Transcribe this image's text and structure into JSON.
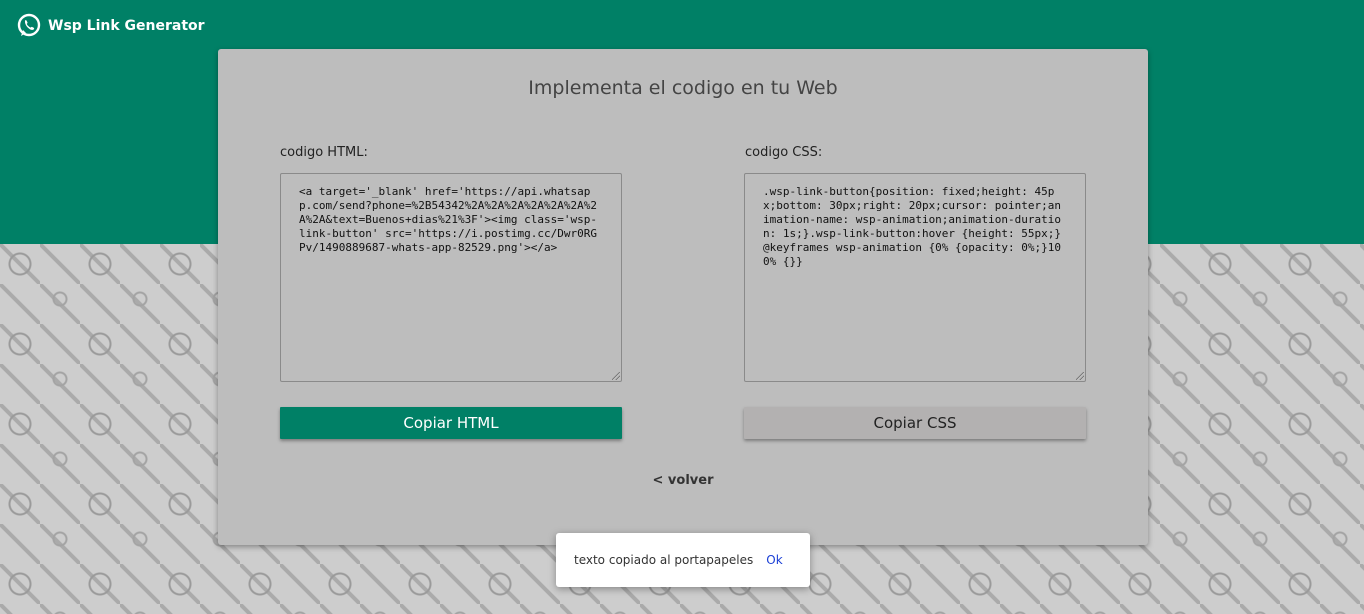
{
  "header": {
    "app_title": "Wsp Link Generator",
    "logo_icon": "whatsapp-icon",
    "brand_color": "#008066"
  },
  "card": {
    "title": "Implementa el codigo en tu Web",
    "html_label": "codigo HTML:",
    "css_label": "codigo CSS:",
    "html_code": "<a target='_blank' href='https://api.whatsapp.com/send?phone=%2B54342%2A%2A%2A%2A%2A%2A%2A%2A&text=Buenos+dias%21%3F'><img class='wsp-link-button' src='https://i.postimg.cc/Dwr0RGPv/1490889687-whats-app-82529.png'></a>",
    "css_code": ".wsp-link-button{position: fixed;height: 45px;bottom: 30px;right: 20px;cursor: pointer;animation-name: wsp-animation;animation-duration: 1s;}.wsp-link-button:hover {height: 55px;}@keyframes wsp-animation {0% {opacity: 0%;}100% {}}",
    "copy_html_label": "Copiar HTML",
    "copy_css_label": "Copiar CSS",
    "back_label": "< volver"
  },
  "toast": {
    "message": "texto copiado al portapapeles",
    "ok_label": "Ok"
  }
}
